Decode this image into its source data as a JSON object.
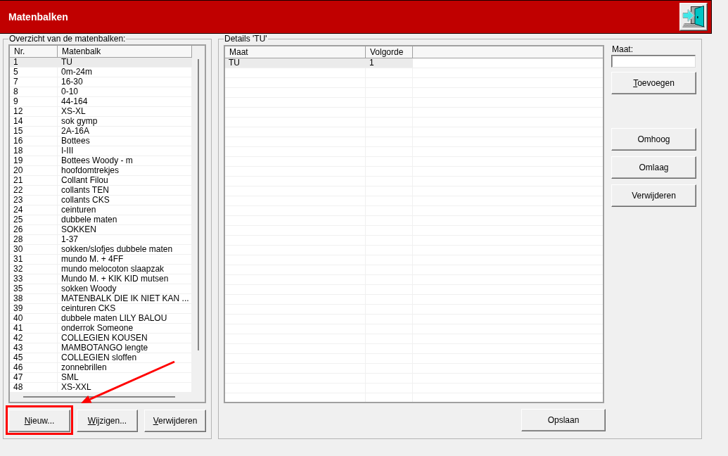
{
  "window": {
    "title": "Matenbalken"
  },
  "overview": {
    "title": "Overzicht van de matenbalken:",
    "columns": [
      "Nr.",
      "Matenbalk"
    ],
    "rows": [
      {
        "cells": [
          "1",
          "TU"
        ],
        "selected": true
      },
      {
        "cells": [
          "5",
          "0m-24m"
        ],
        "selected": false
      },
      {
        "cells": [
          "7",
          "16-30"
        ],
        "selected": false
      },
      {
        "cells": [
          "8",
          "0-10"
        ],
        "selected": false
      },
      {
        "cells": [
          "9",
          "44-164"
        ],
        "selected": false
      },
      {
        "cells": [
          "12",
          "XS-XL"
        ],
        "selected": false
      },
      {
        "cells": [
          "14",
          "sok gymp"
        ],
        "selected": false
      },
      {
        "cells": [
          "15",
          "2A-16A"
        ],
        "selected": false
      },
      {
        "cells": [
          "16",
          "Bottees"
        ],
        "selected": false
      },
      {
        "cells": [
          "18",
          "I-III"
        ],
        "selected": false
      },
      {
        "cells": [
          "19",
          "Bottees Woody - m"
        ],
        "selected": false
      },
      {
        "cells": [
          "20",
          "hoofdomtrekjes"
        ],
        "selected": false
      },
      {
        "cells": [
          "21",
          "Collant Filou"
        ],
        "selected": false
      },
      {
        "cells": [
          "22",
          "collants TEN"
        ],
        "selected": false
      },
      {
        "cells": [
          "23",
          "collants CKS"
        ],
        "selected": false
      },
      {
        "cells": [
          "24",
          "ceinturen"
        ],
        "selected": false
      },
      {
        "cells": [
          "25",
          "dubbele maten"
        ],
        "selected": false
      },
      {
        "cells": [
          "26",
          "SOKKEN"
        ],
        "selected": false
      },
      {
        "cells": [
          "28",
          "1-37"
        ],
        "selected": false
      },
      {
        "cells": [
          "30",
          "sokken/slofjes dubbele maten"
        ],
        "selected": false
      },
      {
        "cells": [
          "31",
          "mundo M. + 4FF"
        ],
        "selected": false
      },
      {
        "cells": [
          "32",
          "mundo melocoton slaapzak"
        ],
        "selected": false
      },
      {
        "cells": [
          "33",
          "Mundo M. + KIK KID mutsen"
        ],
        "selected": false
      },
      {
        "cells": [
          "35",
          "sokken Woody"
        ],
        "selected": false
      },
      {
        "cells": [
          "38",
          "MATENBALK DIE IK NIET KAN ..."
        ],
        "selected": false
      },
      {
        "cells": [
          "39",
          "ceinturen CKS"
        ],
        "selected": false
      },
      {
        "cells": [
          "40",
          "dubbele maten LILY BALOU"
        ],
        "selected": false
      },
      {
        "cells": [
          "41",
          "onderrok Someone"
        ],
        "selected": false
      },
      {
        "cells": [
          "42",
          "COLLEGIEN KOUSEN"
        ],
        "selected": false
      },
      {
        "cells": [
          "43",
          "MAMBOTANGO lengte"
        ],
        "selected": false
      },
      {
        "cells": [
          "45",
          "COLLEGIEN sloffen"
        ],
        "selected": false
      },
      {
        "cells": [
          "46",
          "zonnebrillen"
        ],
        "selected": false
      },
      {
        "cells": [
          "47",
          "SML"
        ],
        "selected": false
      },
      {
        "cells": [
          "48",
          "XS-XXL"
        ],
        "selected": false
      }
    ],
    "buttons": [
      {
        "label": "Nieuw...",
        "mnemonic": true,
        "highlighted": true
      },
      {
        "label": "Wijzigen...",
        "mnemonic": true,
        "highlighted": false
      },
      {
        "label": "Verwijderen",
        "mnemonic": true,
        "highlighted": false
      }
    ]
  },
  "details": {
    "title": "Details 'TU'",
    "columns": [
      "Maat",
      "Volgorde"
    ],
    "rows": [
      {
        "cells": [
          "TU",
          "1"
        ],
        "selected": true
      }
    ],
    "size_field": {
      "label": "Maat:"
    },
    "add_button": {
      "label": "Toevoegen",
      "mnemonic": true
    },
    "order_buttons": [
      {
        "label": "Omhoog",
        "mnemonic": false
      },
      {
        "label": "Omlaag",
        "mnemonic": false
      },
      {
        "label": "Verwijderen",
        "mnemonic": false
      }
    ],
    "save_button": {
      "label": "Opslaan",
      "mnemonic": false
    }
  }
}
